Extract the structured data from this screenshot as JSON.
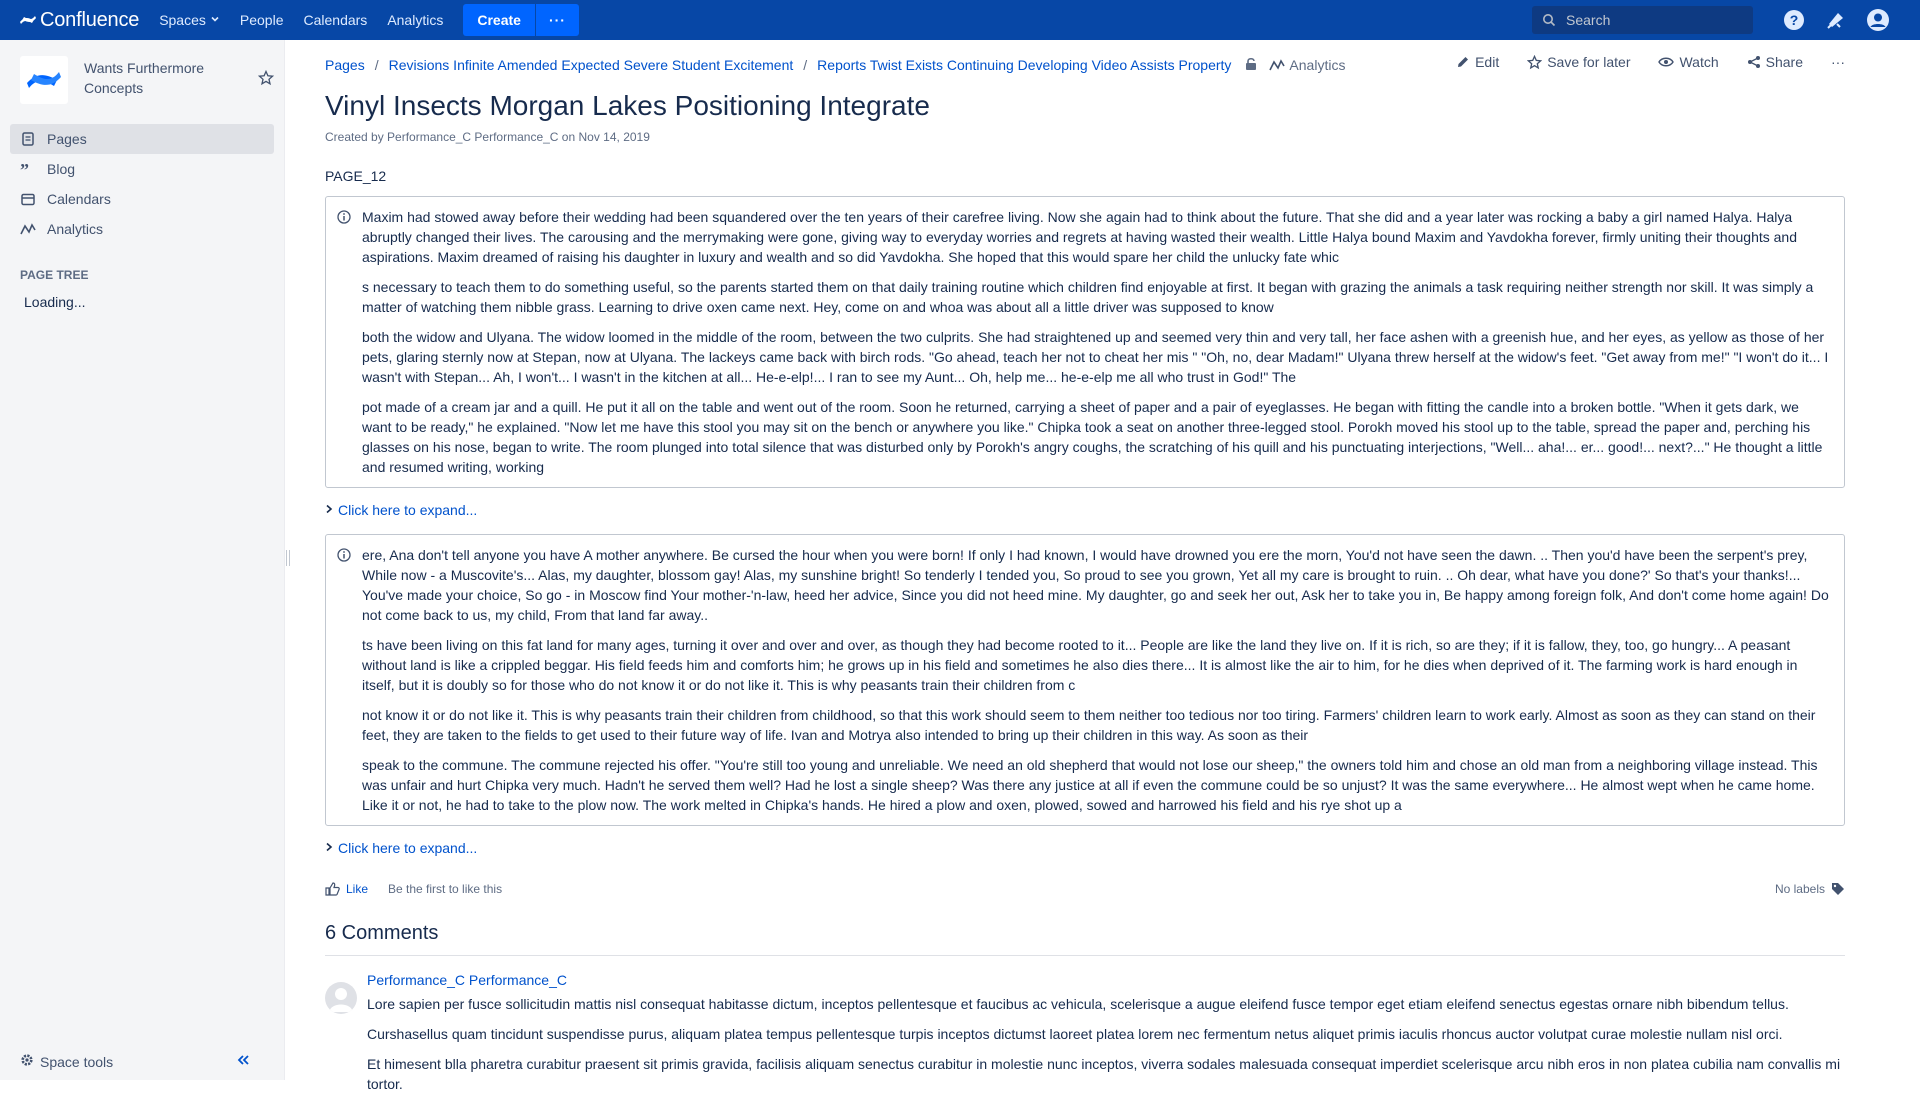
{
  "topbar": {
    "logo_text": "Confluence",
    "nav": [
      {
        "label": "Spaces"
      },
      {
        "label": "People"
      },
      {
        "label": "Calendars"
      },
      {
        "label": "Analytics"
      }
    ],
    "create_label": "Create",
    "more_label": "···",
    "search_placeholder": "Search"
  },
  "sidebar": {
    "space_name": "Wants Furthermore Concepts",
    "items": [
      {
        "label": "Pages",
        "icon": "pages-icon"
      },
      {
        "label": "Blog",
        "icon": "blog-icon"
      },
      {
        "label": "Calendars",
        "icon": "calendar-icon"
      },
      {
        "label": "Analytics",
        "icon": "analytics-icon"
      }
    ],
    "page_tree_heading": "PAGE TREE",
    "loading_text": "Loading...",
    "space_tools_label": "Space tools"
  },
  "breadcrumbs": {
    "items": [
      "Pages",
      "Revisions Infinite Amended Expected Severe Student Excitement",
      "Reports Twist Exists Continuing Developing Video Assists Property"
    ],
    "analytics_label": "Analytics"
  },
  "actions": {
    "edit": "Edit",
    "save_for_later": "Save for later",
    "watch": "Watch",
    "share": "Share",
    "more": "···"
  },
  "page": {
    "title": "Vinyl Insects Morgan Lakes Positioning Integrate",
    "byline_prefix": "Created by",
    "author": "Performance_C Performance_C",
    "byline_on": "on",
    "date": "Nov 14, 2019",
    "code": "PAGE_12",
    "panel1": [
      "Maxim had stowed away before their wedding had been squandered over the ten years of their carefree living. Now she again had to think about the future. That she did and a year later was rocking a baby a girl named Halya. Halya abruptly changed their lives. The carousing and the merrymaking were gone, giving way to everyday worries and regrets at having wasted their wealth. Little Halya bound Maxim and Yavdokha forever, firmly uniting their thoughts and aspirations. Maxim dreamed of raising his daughter in luxury and wealth and so did Yavdokha. She hoped that this would spare her child the unlucky fate whic",
      "s necessary to teach them to do something useful, so the parents started them on that daily training routine which children find enjoyable at first. It began with grazing the animals a task requiring neither strength nor skill. It was simply a matter of watching them nibble grass. Learning to drive oxen came next. Hey, come on and whoa was about all a little driver was supposed to know",
      "both the widow and Ulyana. The widow loomed in the middle of the room, between the two culprits. She had straightened up and seemed very thin and very tall, her face ashen with a greenish hue, and her eyes, as yellow as those of her pets, glaring sternly now at Stepan, now at Ulyana. The lackeys came back with birch rods. \"Go ahead, teach her not to cheat her mis \" \"Oh, no, dear Madam!\" Ulyana threw herself at the widow's feet. \"Get away from me!\" \"I won't do it... I wasn't with Stepan... Ah, I won't... I wasn't in the kitchen at all... He-e-elp!... I ran to see my Aunt... Oh, help me... he-e-elp me all who trust in God!\" The",
      "pot made of a cream jar and a quill. He put it all on the table and went out of the room. Soon he returned, carrying a sheet of paper and a pair of eyeglasses. He began with fitting the candle into a broken bottle. \"When it gets dark, we want to be ready,\" he explained. \"Now let me have this stool you may sit on the bench or anywhere you like.\" Chipka took a seat on another three-legged stool. Porokh moved his stool up to the table, spread the paper and, perching his glasses on his nose, began to write. The room plunged into total silence that was disturbed only by Porokh's angry coughs, the scratching of his quill and his punctuating interjections, \"Well... aha!... er... good!... next?...\" He thought a little and resumed writing, working"
    ],
    "expand_label": "Click here to expand...",
    "panel2": [
      "ere, Ana don't tell anyone you have A mother anywhere. Be cursed the hour when you were born! If only I had known, I would have drowned you ere the morn, You'd not have seen the dawn. .. Then you'd have been the serpent's prey, While now - a Muscovite's... Alas, my daughter, blossom gay! Alas, my sunshine bright! So tenderly I tended you, So proud to see you grown, Yet all my care is brought to ruin. .. Oh dear, what have you done?' So that's your thanks!... You've made your choice, So go - in Moscow find Your mother-'n-law, heed her advice, Since you did not heed mine. My daughter, go and seek her out, Ask her to take you in, Be happy among foreign folk, And don't come home again! Do not come back to us, my child, From that land far away..",
      "ts have been living on this fat land for many ages, turning it over and over and over, as though they had become rooted to it... People are like the land they live on. If it is rich, so are they; if it is fallow, they, too, go hungry... A peasant without land is like a crippled beggar. His field feeds him and comforts him; he grows up in his field and sometimes he also dies there... It is almost like the air to him, for he dies when deprived of it. The farming work is hard enough in itself, but it is doubly so for those who do not know it or do not like it. This is why peasants train their children from c",
      "not know it or do not like it. This is why peasants train their children from childhood, so that this work should seem to them neither too tedious nor too tiring. Farmers' children learn to work early. Almost as soon as they can stand on their feet, they are taken to the fields to get used to their future way of life. Ivan and Motrya also intended to bring up their children in this way. As soon as their",
      "speak to the commune. The commune rejected his offer. \"You're still too young and unreliable. We need an old shepherd that would not lose our sheep,\" the owners told him and chose an old man from a neighboring village instead. This was unfair and hurt Chipka very much. Hadn't he served them well? Had he lost a single sheep? Was there any justice at all if even the commune could be so unjust? It was the same everywhere... He almost wept when he came home. Like it or not, he had to take to the plow now. The work melted in Chipka's hands. He hired a plow and oxen, plowed, sowed and harrowed his field and his rye shot up a"
    ],
    "expand_label2": "Click here to expand...",
    "like_label": "Like",
    "first_like": "Be the first to like this",
    "no_labels": "No labels"
  },
  "comments": {
    "heading": "6 Comments",
    "first": {
      "author": "Performance_C Performance_C",
      "paragraphs": [
        "Lore sapien per fusce sollicitudin mattis nisl consequat habitasse dictum, inceptos pellentesque et faucibus ac vehicula, scelerisque a augue eleifend fusce tempor eget etiam eleifend senectus egestas ornare nibh bibendum tellus.",
        "Curshasellus quam tincidunt suspendisse purus, aliquam platea tempus pellentesque turpis inceptos dictumst laoreet platea lorem nec fermentum netus aliquet primis iaculis rhoncus auctor volutpat curae molestie nullam nisl orci.",
        "Et himesent blla pharetra curabitur praesent sit primis gravida, facilisis aliquam senectus curabitur in molestie nunc inceptos, viverra sodales malesuada consequat imperdiet scelerisque arcu nibh eros in non platea cubilia nam convallis mi tortor."
      ]
    }
  },
  "colors": {
    "topbar": "#0747a6",
    "link": "#0052cc",
    "create": "#0065ff"
  }
}
